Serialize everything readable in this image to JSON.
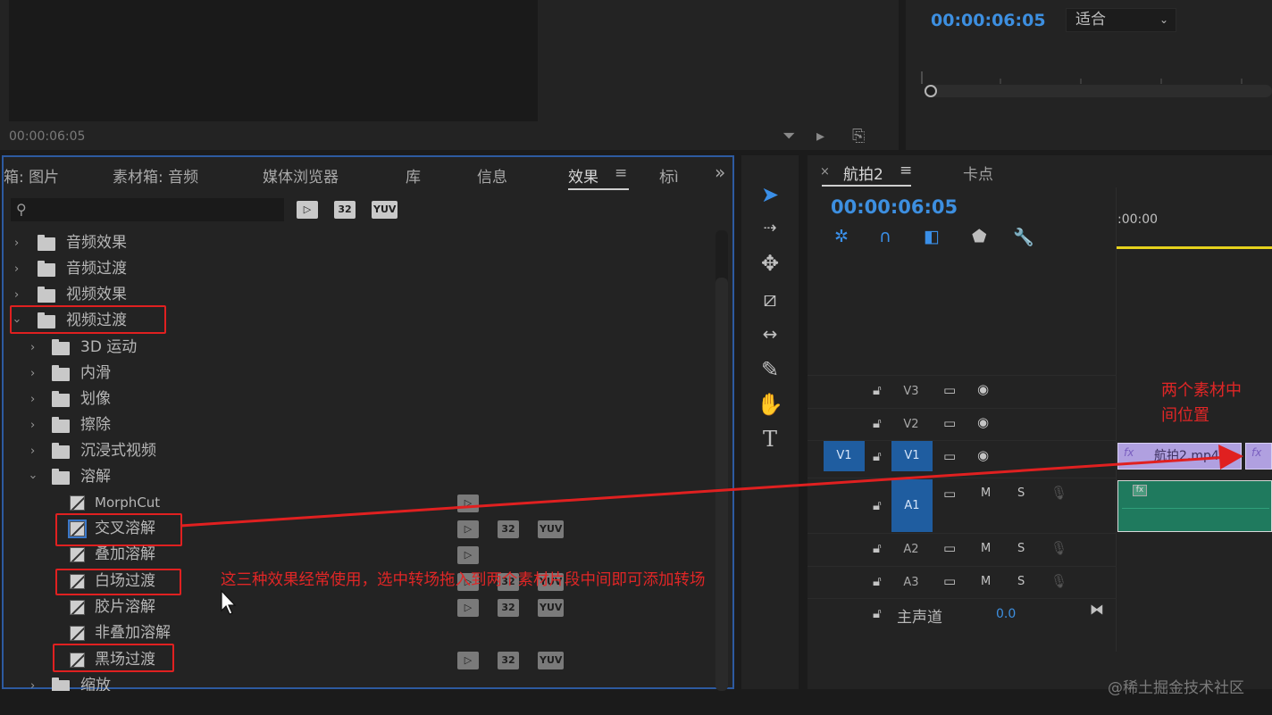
{
  "source_monitor": {
    "timecode": "00:00:06:05"
  },
  "program_monitor": {
    "timecode": "00:00:06:05",
    "fit": "适合"
  },
  "effects_panel": {
    "tabs": [
      "箱: 图片",
      "素材箱: 音频",
      "媒体浏览器",
      "库",
      "信息",
      "效果",
      "标ì"
    ],
    "active_tab": "效果",
    "menu_icon": "≡",
    "overflow_icon": "»",
    "search_placeholder": "",
    "badges": [
      "▷",
      "32",
      "YUV"
    ],
    "tree": {
      "folders": [
        "音频效果",
        "音频过渡",
        "视频效果",
        "视频过渡"
      ],
      "subfolders": [
        "3D 运动",
        "内滑",
        "划像",
        "擦除",
        "沉浸式视频",
        "溶解"
      ],
      "dissolve_items": [
        "MorphCut",
        "交叉溶解",
        "叠加溶解",
        "白场过渡",
        "胶片溶解",
        "非叠加溶解",
        "黑场过渡"
      ],
      "last_folder": "缩放"
    }
  },
  "tools": [
    "selection-tool",
    "track-select-tool",
    "ripple-edit-tool",
    "razor-tool",
    "slip-tool",
    "pen-tool",
    "hand-tool",
    "type-tool"
  ],
  "timeline": {
    "sequence_tab": "航拍2",
    "second_tab": "卡点",
    "timecode": "00:00:06:05",
    "ruler_start": ":00:00",
    "tracks": {
      "video": [
        "V3",
        "V2",
        "V1"
      ],
      "audio": [
        "A1",
        "A2",
        "A3"
      ],
      "source_patch": "V1",
      "mute": "M",
      "solo": "S",
      "master": "主声道",
      "master_value": "0.0"
    },
    "clip_name": "航拍2.mp4",
    "fx_label": "fx"
  },
  "annotations": {
    "between_clips": "两个素材中\n间位置",
    "instruction": "这三种效果经常使用，选中转场拖入到两个素材片段中间即可添加转场"
  },
  "watermark": "@稀土掘金技术社区",
  "colors": {
    "accent_blue": "#3d8fe0",
    "annotation_red": "#e02020",
    "playhead_yellow": "#e6d21d",
    "clip_video": "#b0a0e0",
    "clip_audio": "#1f7a5e"
  }
}
